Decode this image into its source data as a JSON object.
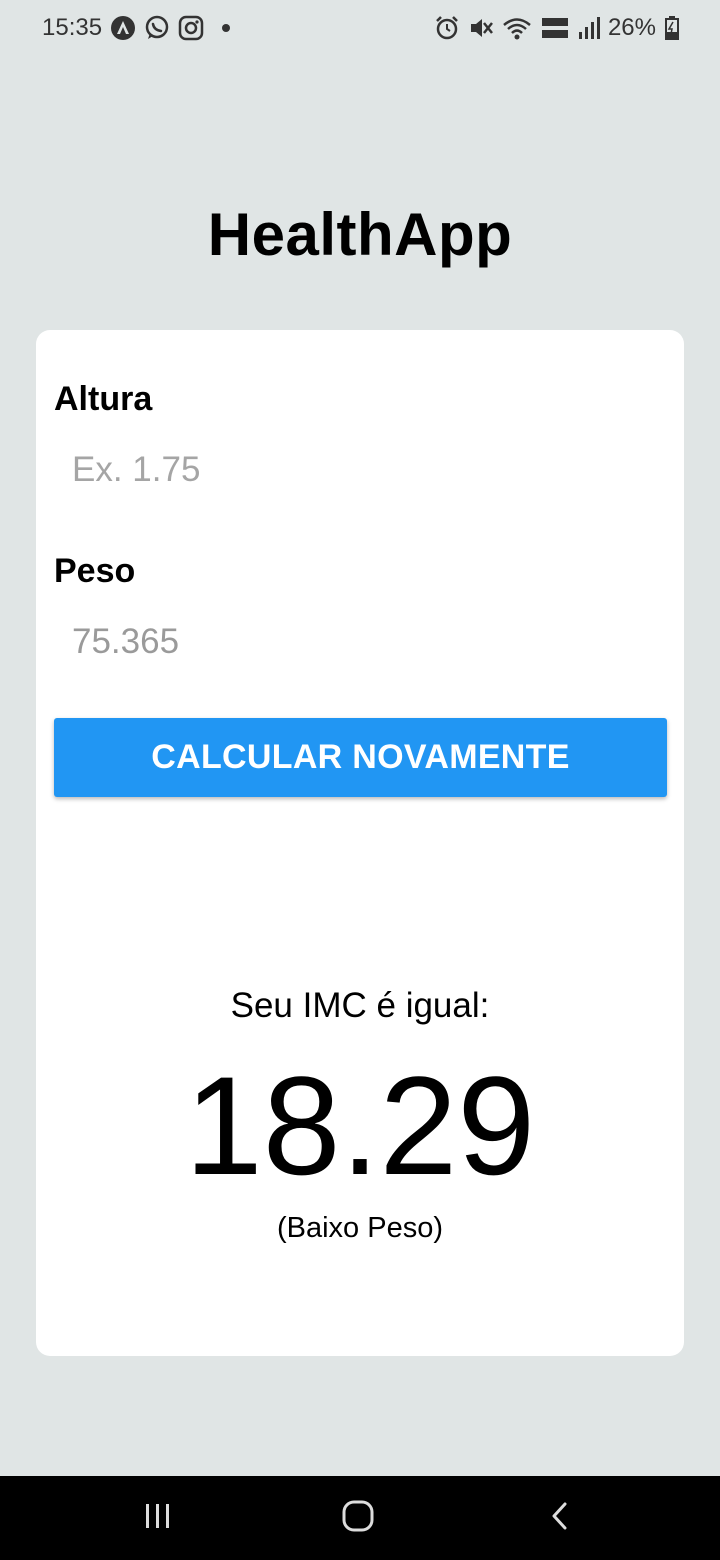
{
  "status_bar": {
    "time": "15:35",
    "battery": "26%",
    "left_icons": [
      "autopilot-icon",
      "whatsapp-icon",
      "instagram-icon",
      "notification-dot-icon"
    ],
    "right_icons": [
      "alarm-icon",
      "mute-icon",
      "wifi-icon",
      "volte-lte2-icon",
      "signal-icon",
      "battery-charging-icon"
    ]
  },
  "app": {
    "title": "HealthApp"
  },
  "form": {
    "height": {
      "label": "Altura",
      "placeholder": "Ex. 1.75",
      "value": ""
    },
    "weight": {
      "label": "Peso",
      "placeholder": "",
      "value": "75.365"
    },
    "button_label": "CALCULAR NOVAMENTE"
  },
  "result": {
    "caption": "Seu IMC é igual:",
    "value": "18.29",
    "classification": "(Baixo Peso)"
  },
  "nav_bar": {
    "buttons": [
      "recent-apps-icon",
      "home-icon",
      "back-icon"
    ]
  },
  "colors": {
    "background": "#e0e5e5",
    "card": "#ffffff",
    "button": "#2196f3",
    "placeholder": "#a5a5a5"
  }
}
